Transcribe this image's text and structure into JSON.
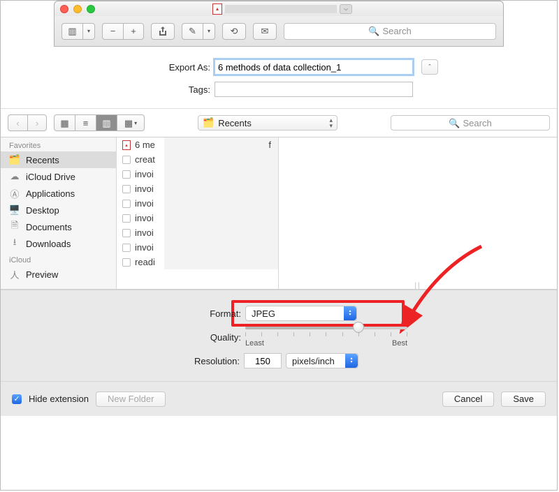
{
  "window": {
    "title_redacted": "",
    "title_caret": "⌵"
  },
  "toolbar": {
    "search_placeholder": "Search"
  },
  "export": {
    "label": "Export As:",
    "value": "6 methods of data collection_1",
    "tags_label": "Tags:"
  },
  "browse": {
    "location": "Recents",
    "search_placeholder": "Search"
  },
  "sidebar": {
    "section_fav": "Favorites",
    "items": [
      {
        "label": "Recents"
      },
      {
        "label": "iCloud Drive"
      },
      {
        "label": "Applications"
      },
      {
        "label": "Desktop"
      },
      {
        "label": "Documents"
      },
      {
        "label": "Downloads"
      }
    ],
    "section_icloud": "iCloud",
    "icloud_items": [
      {
        "label": "Preview"
      }
    ]
  },
  "files": [
    {
      "name": "6 me",
      "tail": "f",
      "pdf": true
    },
    {
      "name": "creat"
    },
    {
      "name": "invoi"
    },
    {
      "name": "invoi"
    },
    {
      "name": "invoi"
    },
    {
      "name": "invoi"
    },
    {
      "name": "invoi"
    },
    {
      "name": "invoi"
    },
    {
      "name": "readi"
    }
  ],
  "format": {
    "label": "Format:",
    "value": "JPEG"
  },
  "quality": {
    "label": "Quality:",
    "least": "Least",
    "best": "Best"
  },
  "resolution": {
    "label": "Resolution:",
    "value": "150",
    "unit": "pixels/inch"
  },
  "footer": {
    "hide_ext": "Hide extension",
    "new_folder": "New Folder",
    "cancel": "Cancel",
    "save": "Save"
  }
}
